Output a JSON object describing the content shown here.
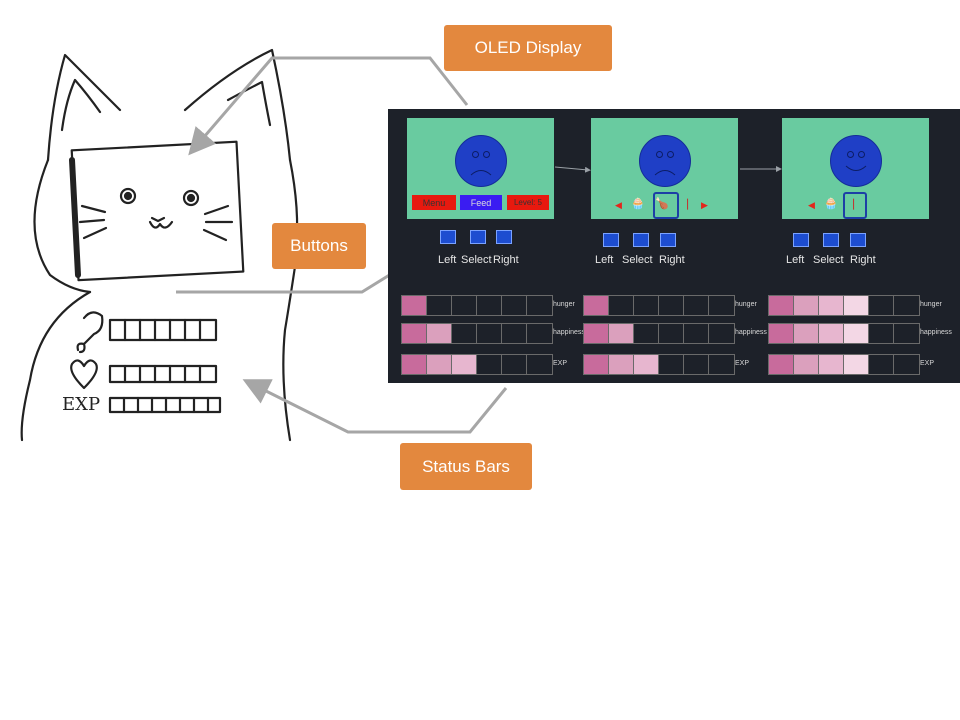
{
  "callouts": {
    "oled": "OLED Display",
    "buttons": "Buttons",
    "status": "Status Bars"
  },
  "sketch": {
    "exp_label": "EXP"
  },
  "screens": [
    {
      "mood": "sad",
      "menu": [
        "Menu",
        "Feed",
        "Level: 5"
      ]
    },
    {
      "mood": "sad",
      "items": [
        "left-arrow",
        "cupcake",
        "turkey",
        "candy-cane",
        "right-arrow"
      ]
    },
    {
      "mood": "happy",
      "items": [
        "left-arrow",
        "cupcake",
        "candy-cane"
      ]
    }
  ],
  "buttons": [
    "Left",
    "Select",
    "Right"
  ],
  "bar_labels": [
    "hunger",
    "happiness",
    "EXP"
  ],
  "stats": [
    {
      "hunger": 1,
      "happiness": 2,
      "exp": 3
    },
    {
      "hunger": 1,
      "happiness": 2,
      "exp": 3
    },
    {
      "hunger": 4,
      "happiness": 4,
      "exp": 4
    }
  ],
  "colors": {
    "callout": "#e3883e",
    "screen": "#69cba0",
    "face": "#1f3fc6",
    "bar_fill": [
      "#c86b9c",
      "#dba0bd",
      "#e7b6cf",
      "#f3d7e5"
    ]
  }
}
